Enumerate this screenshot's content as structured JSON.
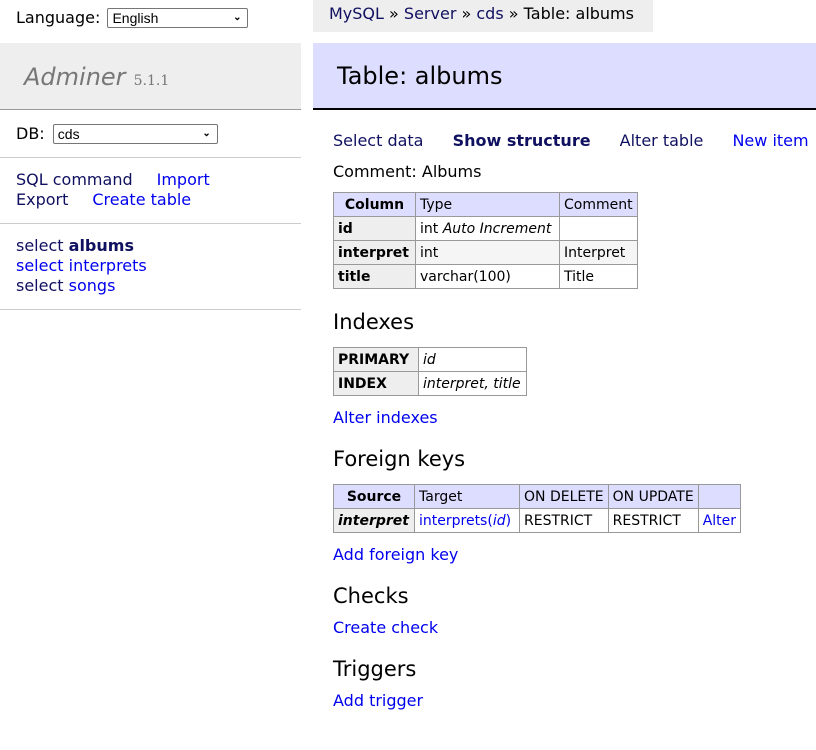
{
  "language": {
    "label": "Language:",
    "selected": "English"
  },
  "app": {
    "name": "Adminer",
    "version": "5.1.1"
  },
  "sidebar": {
    "db_label": "DB:",
    "db_selected": "cds",
    "links": [
      {
        "label": "SQL command"
      },
      {
        "label": "Import"
      },
      {
        "label": "Export"
      },
      {
        "label": "Create table"
      }
    ],
    "tables": [
      {
        "prefix": "select",
        "name": "albums",
        "active": true
      },
      {
        "prefix": "select",
        "name": "interprets",
        "active": false
      },
      {
        "prefix": "select",
        "name": "songs",
        "active": false
      }
    ]
  },
  "breadcrumb": {
    "items": [
      "MySQL",
      "Server",
      "cds"
    ],
    "separator": "»",
    "current": "Table: albums"
  },
  "header": {
    "title": "Table: albums"
  },
  "tabs": {
    "select_data": "Select data",
    "show_structure": "Show structure",
    "alter_table": "Alter table",
    "new_item": "New item"
  },
  "comment": "Comment: Albums",
  "columns_table": {
    "headers": [
      "Column",
      "Type",
      "Comment"
    ],
    "rows": [
      {
        "column": "id",
        "type": "int",
        "extra": "Auto Increment",
        "comment": ""
      },
      {
        "column": "interpret",
        "type": "int",
        "extra": "",
        "comment": "Interpret"
      },
      {
        "column": "title",
        "type": "varchar(100)",
        "extra": "",
        "comment": "Title"
      }
    ]
  },
  "indexes": {
    "heading": "Indexes",
    "rows": [
      {
        "type": "PRIMARY",
        "columns": "id"
      },
      {
        "type": "INDEX",
        "columns": "interpret, title"
      }
    ],
    "alter_link": "Alter indexes"
  },
  "foreign_keys": {
    "heading": "Foreign keys",
    "headers": [
      "Source",
      "Target",
      "ON DELETE",
      "ON UPDATE",
      ""
    ],
    "rows": [
      {
        "source": "interpret",
        "target_table": "interprets",
        "target_column": "id",
        "on_delete": "RESTRICT",
        "on_update": "RESTRICT",
        "action": "Alter"
      }
    ],
    "add_link": "Add foreign key"
  },
  "checks": {
    "heading": "Checks",
    "create_link": "Create check"
  },
  "triggers": {
    "heading": "Triggers",
    "add_link": "Add trigger"
  }
}
